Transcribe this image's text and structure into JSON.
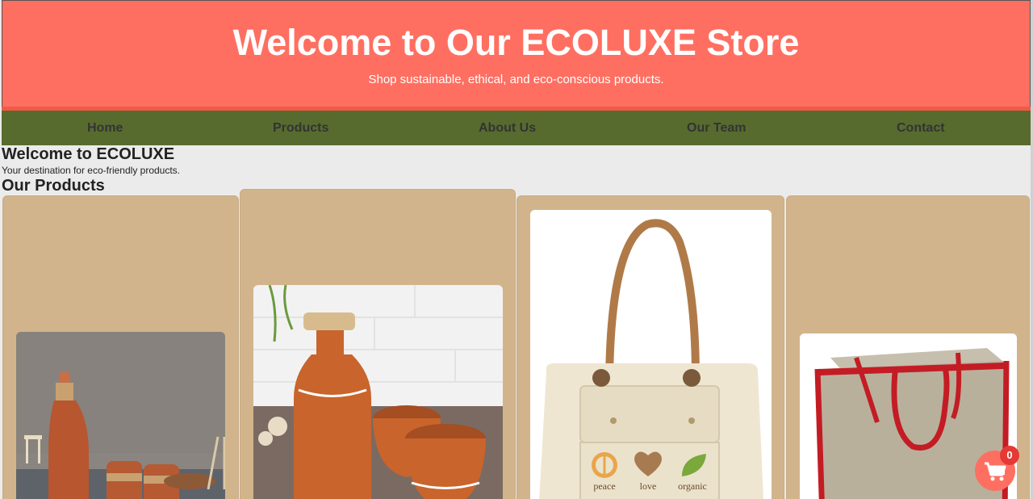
{
  "header": {
    "title": "Welcome to Our ECOLUXE Store",
    "subtitle": "Shop sustainable, ethical, and eco-conscious products."
  },
  "nav": {
    "items": [
      {
        "label": "Home"
      },
      {
        "label": "Products"
      },
      {
        "label": "About Us"
      },
      {
        "label": "Our Team"
      },
      {
        "label": "Contact"
      }
    ]
  },
  "intro": {
    "title": "Welcome to ECOLUXE",
    "subtitle": "Your destination for eco-friendly products."
  },
  "products": {
    "title": "Our Products",
    "items": [
      {
        "image": "terracotta-bottle-and-cups-photo"
      },
      {
        "image": "terracotta-bottle-with-cork-photo"
      },
      {
        "image": "canvas-tote-bag-photo"
      },
      {
        "image": "jute-bag-with-red-handles-photo"
      }
    ]
  },
  "cart": {
    "icon": "shopping-cart-icon",
    "count": "0"
  },
  "colors": {
    "header_bg": "#ff6f61",
    "nav_bg": "#586b2f",
    "card_bg": "#d2b48c",
    "page_bg": "#ebebeb"
  }
}
